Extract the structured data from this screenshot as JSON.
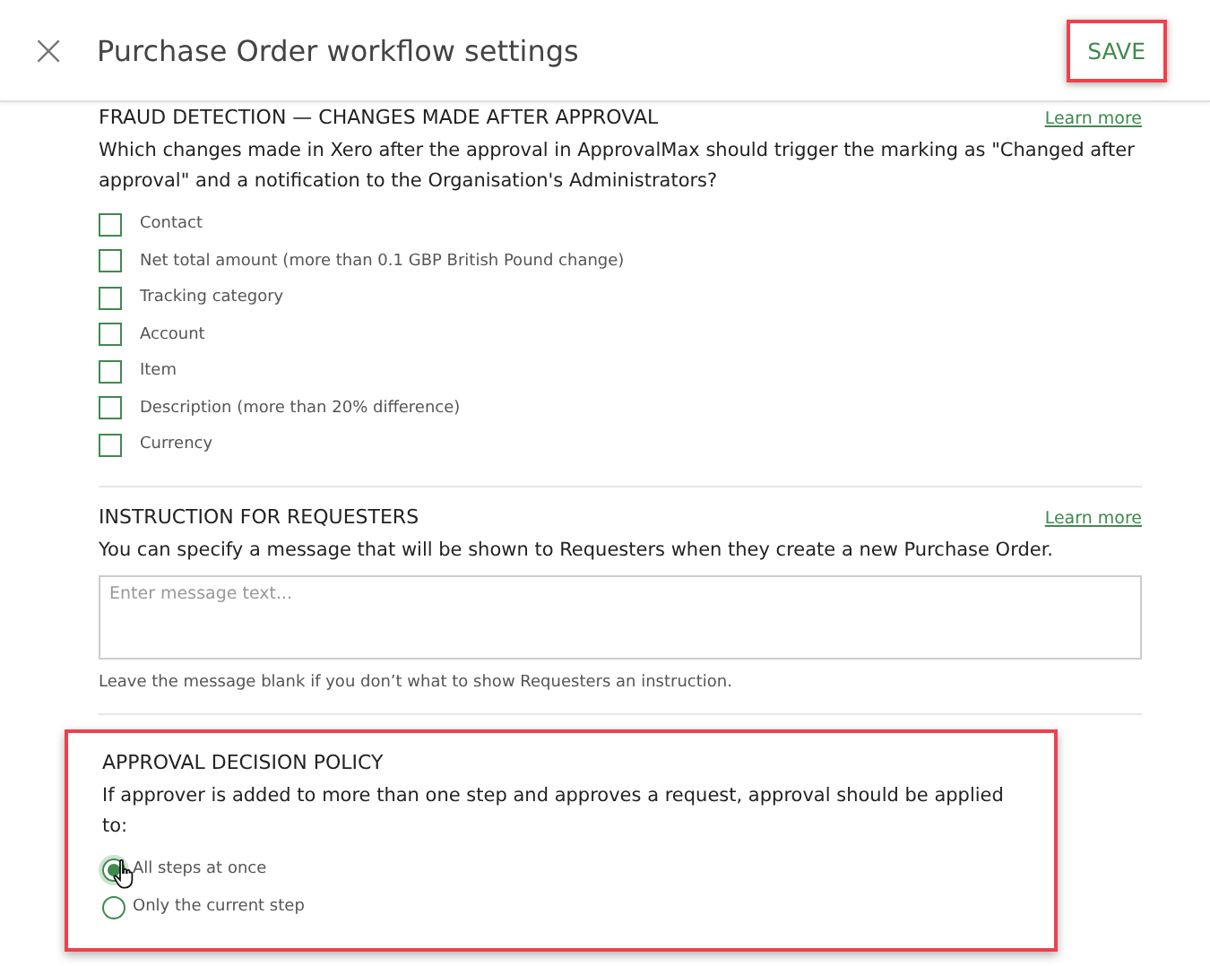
{
  "header": {
    "close": "×",
    "title": "Purchase Order workflow settings",
    "save": {
      "label": "SAVE",
      "highlighted": true
    }
  },
  "sections": [
    {
      "kind": "checkboxes",
      "title": "FRAUD DETECTION — CHANGES MADE AFTER APPROVAL",
      "link": "Learn more",
      "description": "Which changes made in Xero after the approval in ApprovalMax should trigger the marking as \"Changed after approval\" and a notification to the Organisation's Administrators?",
      "highlighted": false,
      "options": [
        {
          "label": "Contact",
          "checked": false
        },
        {
          "label": "Net total amount (more than 0.1 GBP British Pound change)",
          "checked": false
        },
        {
          "label": "Tracking category",
          "checked": false
        },
        {
          "label": "Account",
          "checked": false
        },
        {
          "label": "Item",
          "checked": false
        },
        {
          "label": "Description (more than 20% difference)",
          "checked": false
        },
        {
          "label": "Currency",
          "checked": false
        }
      ]
    },
    {
      "kind": "message",
      "title": "INSTRUCTION FOR REQUESTERS",
      "link": "Learn more",
      "description": "You can specify a message that will be shown to Requesters when they create a new Purchase Order.",
      "highlighted": false,
      "placeholder": "Enter message text...",
      "hint": "Leave the message blank if you don’t what to show Requesters an instruction."
    },
    {
      "kind": "radios",
      "title": "APPROVAL DECISION POLICY",
      "description": "If approver is added to more than one step and approves a request, approval should be applied to:",
      "highlighted": true,
      "options": [
        {
          "label": "All steps at once",
          "selected": true
        },
        {
          "label": "Only the current step",
          "selected": false
        }
      ]
    }
  ]
}
